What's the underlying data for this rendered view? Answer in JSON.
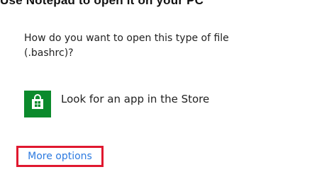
{
  "header": {
    "cut_text": "Use Notepad to open it on your PC"
  },
  "dialog": {
    "question": "How do you want to open this type of file (.bashrc)?",
    "store_option": {
      "label": "Look for an app in the Store",
      "icon": "store-bag-icon",
      "tile_color": "#0b8a2c"
    },
    "more_options": {
      "label": "More options",
      "link_color": "#2c7ae0",
      "highlight_color": "#e0182f"
    }
  }
}
